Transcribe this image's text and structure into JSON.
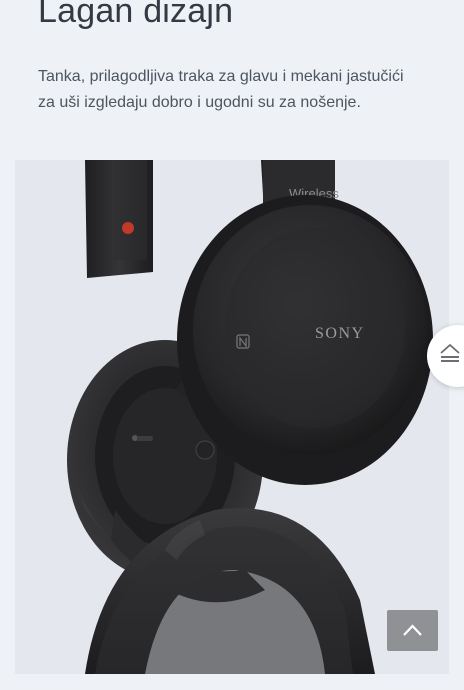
{
  "section": {
    "heading": "Lagan dizajn",
    "description": "Tanka, prilagodljiva traka za glavu i mekani jastučići za uši izgledaju dobro i ugodni su za nošenje."
  },
  "product": {
    "headband_label": "Wireless",
    "brand_label": "SONY",
    "nfc_icon": "nfc-icon"
  },
  "controls": {
    "side_button_icon": "eject-icon",
    "scroll_top_icon": "chevron-up-icon"
  },
  "colors": {
    "background": "#eef1f6",
    "image_background": "#e4e7ed",
    "headphone_body": "#2a2a2c",
    "scroll_button": "#8f9195"
  }
}
